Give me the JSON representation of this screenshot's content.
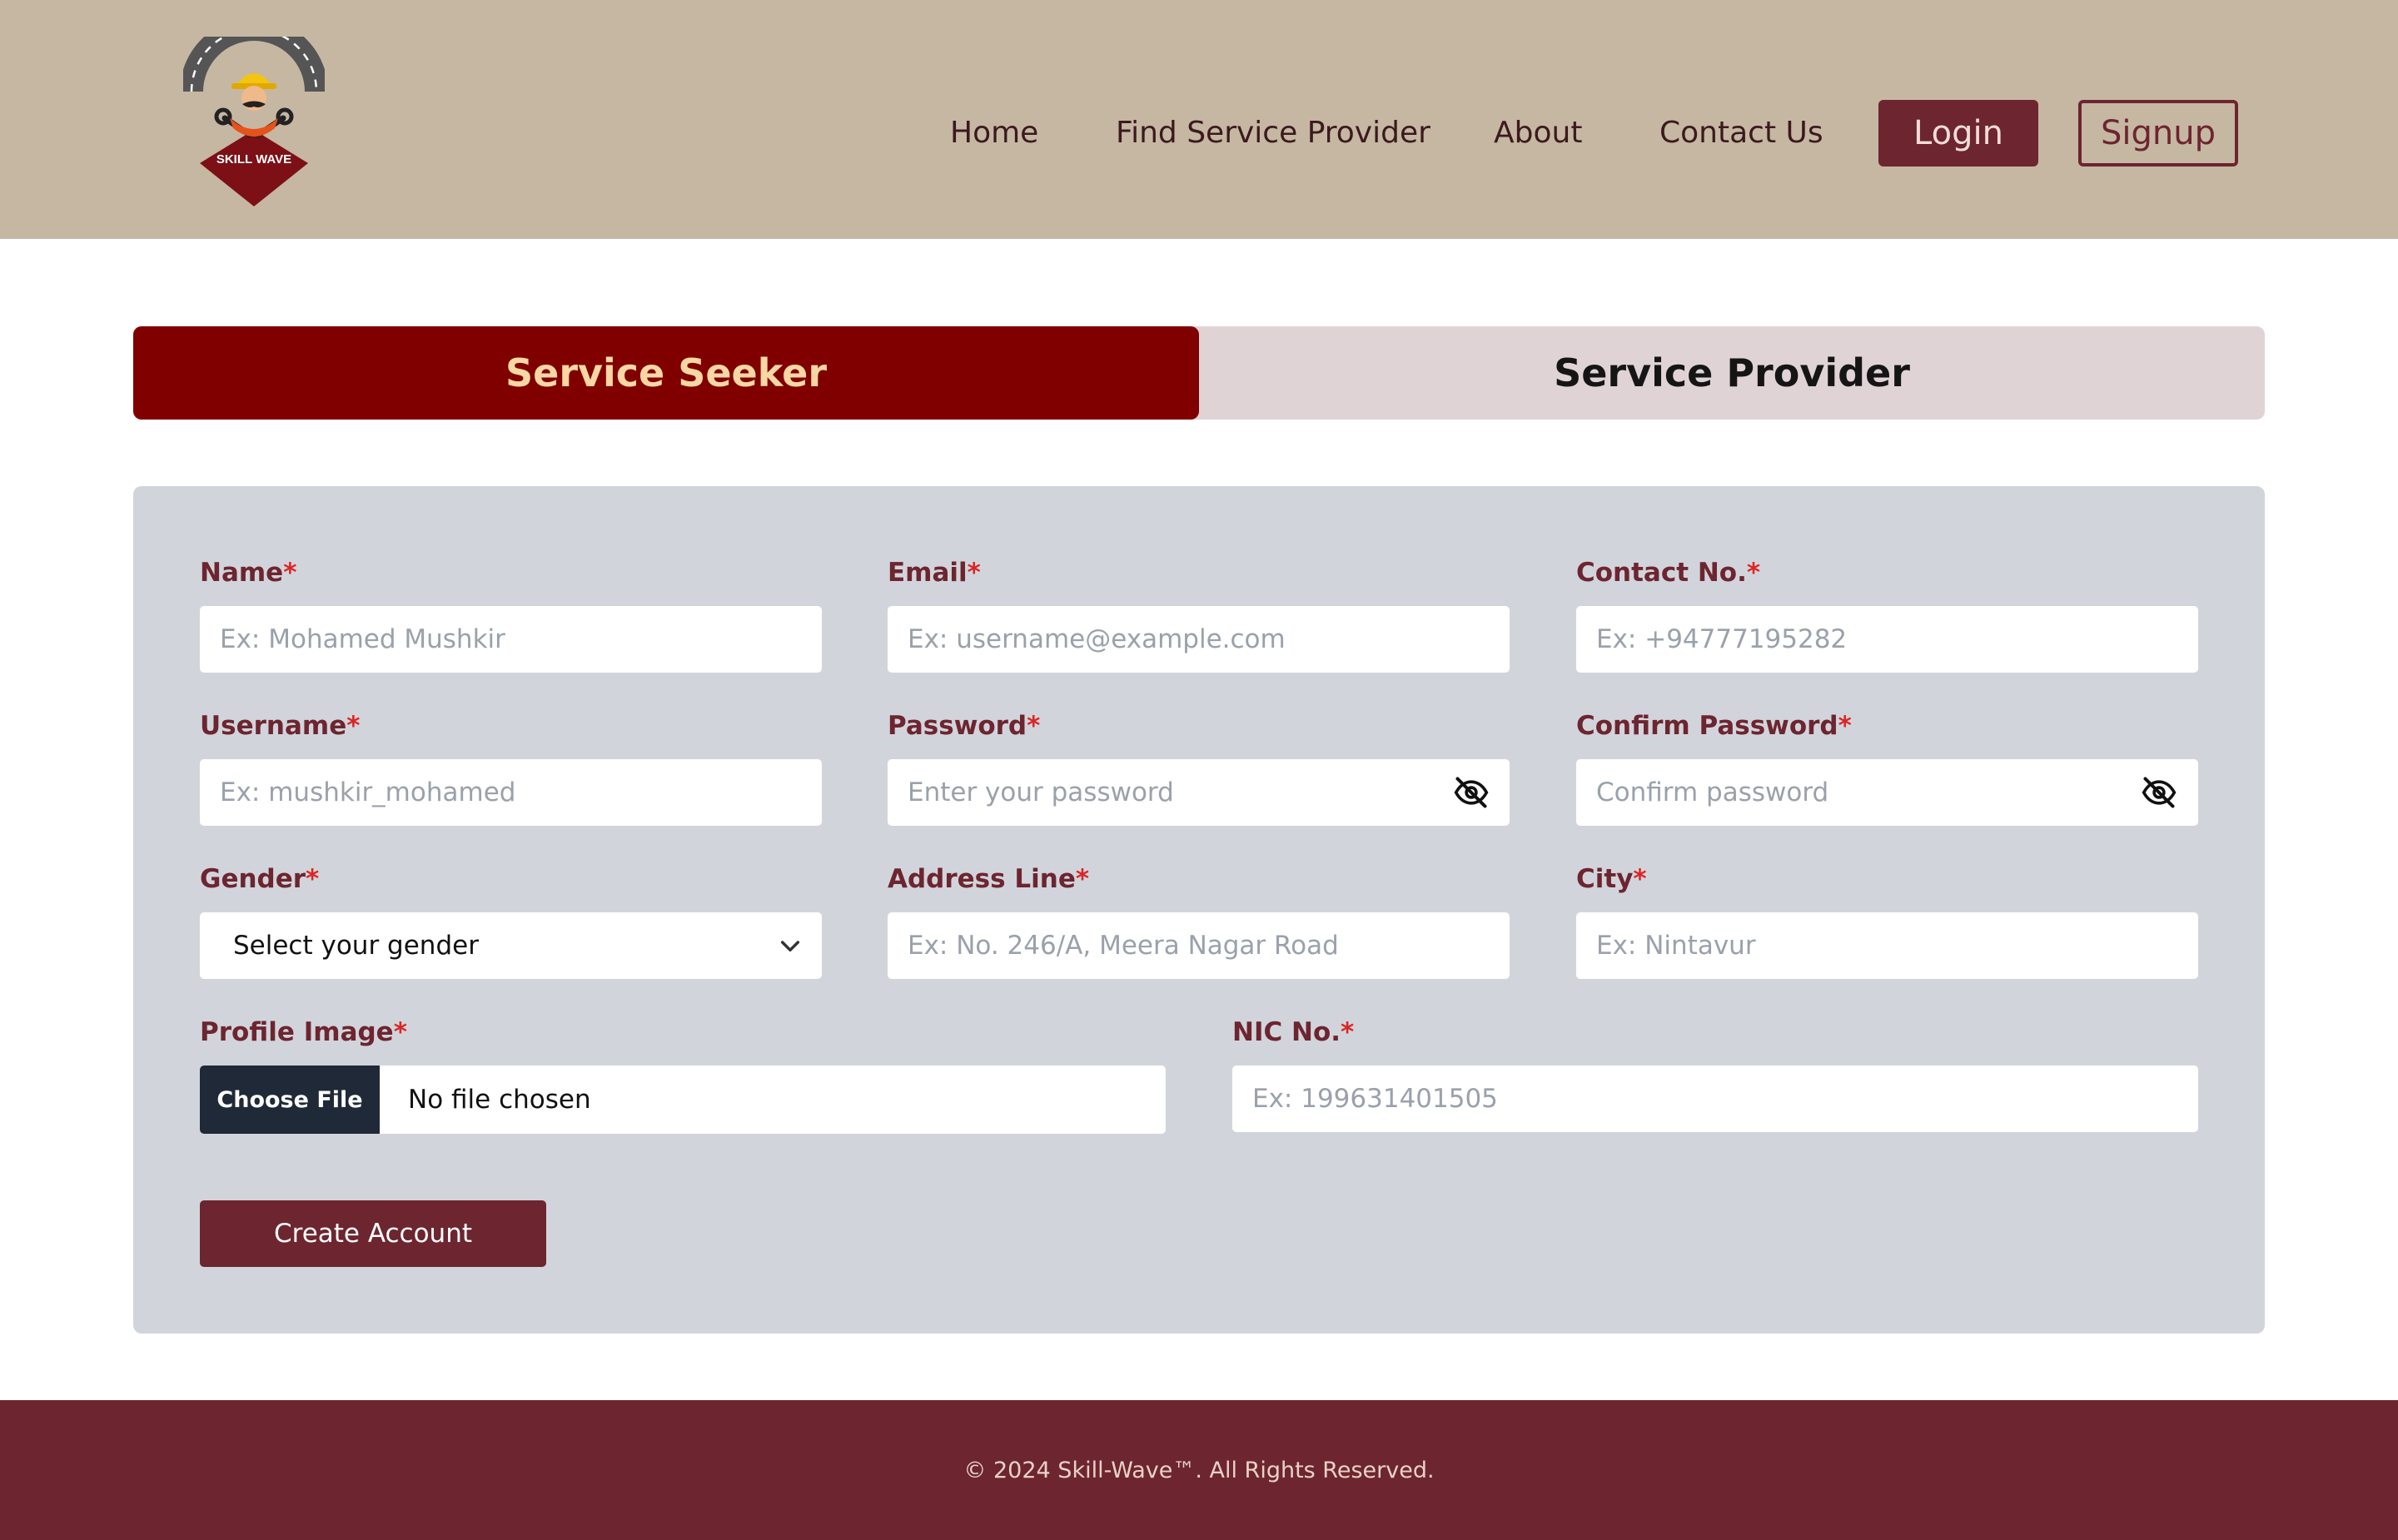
{
  "brand": {
    "logo_text": "SKILL WAVE",
    "colors": {
      "header_bg": "#c6b7a2",
      "accent": "#6d2530",
      "tab_active": "#800000",
      "tab_active_text": "#f7d7a4",
      "tab_inactive_bg": "#e0d3d6",
      "form_bg": "#d1d5db",
      "required": "#dc2626"
    }
  },
  "nav": {
    "items": [
      {
        "label": "Home"
      },
      {
        "label": "Find Service Provider"
      },
      {
        "label": "About"
      },
      {
        "label": "Contact Us"
      }
    ],
    "login_label": "Login",
    "signup_label": "Signup"
  },
  "tabs": [
    {
      "label": "Service Seeker",
      "active": true
    },
    {
      "label": "Service Provider",
      "active": false
    }
  ],
  "form": {
    "required_mark": "*",
    "name": {
      "label": "Name",
      "placeholder": "Ex: Mohamed Mushkir"
    },
    "email": {
      "label": "Email",
      "placeholder": "Ex: username@example.com"
    },
    "contact": {
      "label": "Contact No.",
      "placeholder": "Ex: +94777195282"
    },
    "username": {
      "label": "Username",
      "placeholder": "Ex: mushkir_mohamed"
    },
    "password": {
      "label": "Password",
      "placeholder": "Enter your password",
      "icon": "eye-slash-icon"
    },
    "confirm_password": {
      "label": "Confirm Password",
      "placeholder": "Confirm password",
      "icon": "eye-slash-icon"
    },
    "gender": {
      "label": "Gender",
      "selected": "Select your gender"
    },
    "address": {
      "label": "Address Line",
      "placeholder": "Ex: No. 246/A, Meera Nagar Road"
    },
    "city": {
      "label": "City",
      "placeholder": "Ex: Nintavur"
    },
    "profile_image": {
      "label": "Profile Image",
      "button": "Choose File",
      "status": "No file chosen"
    },
    "nic": {
      "label": "NIC No.",
      "placeholder": "Ex: 199631401505"
    },
    "submit_label": "Create Account"
  },
  "footer": {
    "copyright": "© 2024 Skill-Wave™. All Rights Reserved."
  }
}
